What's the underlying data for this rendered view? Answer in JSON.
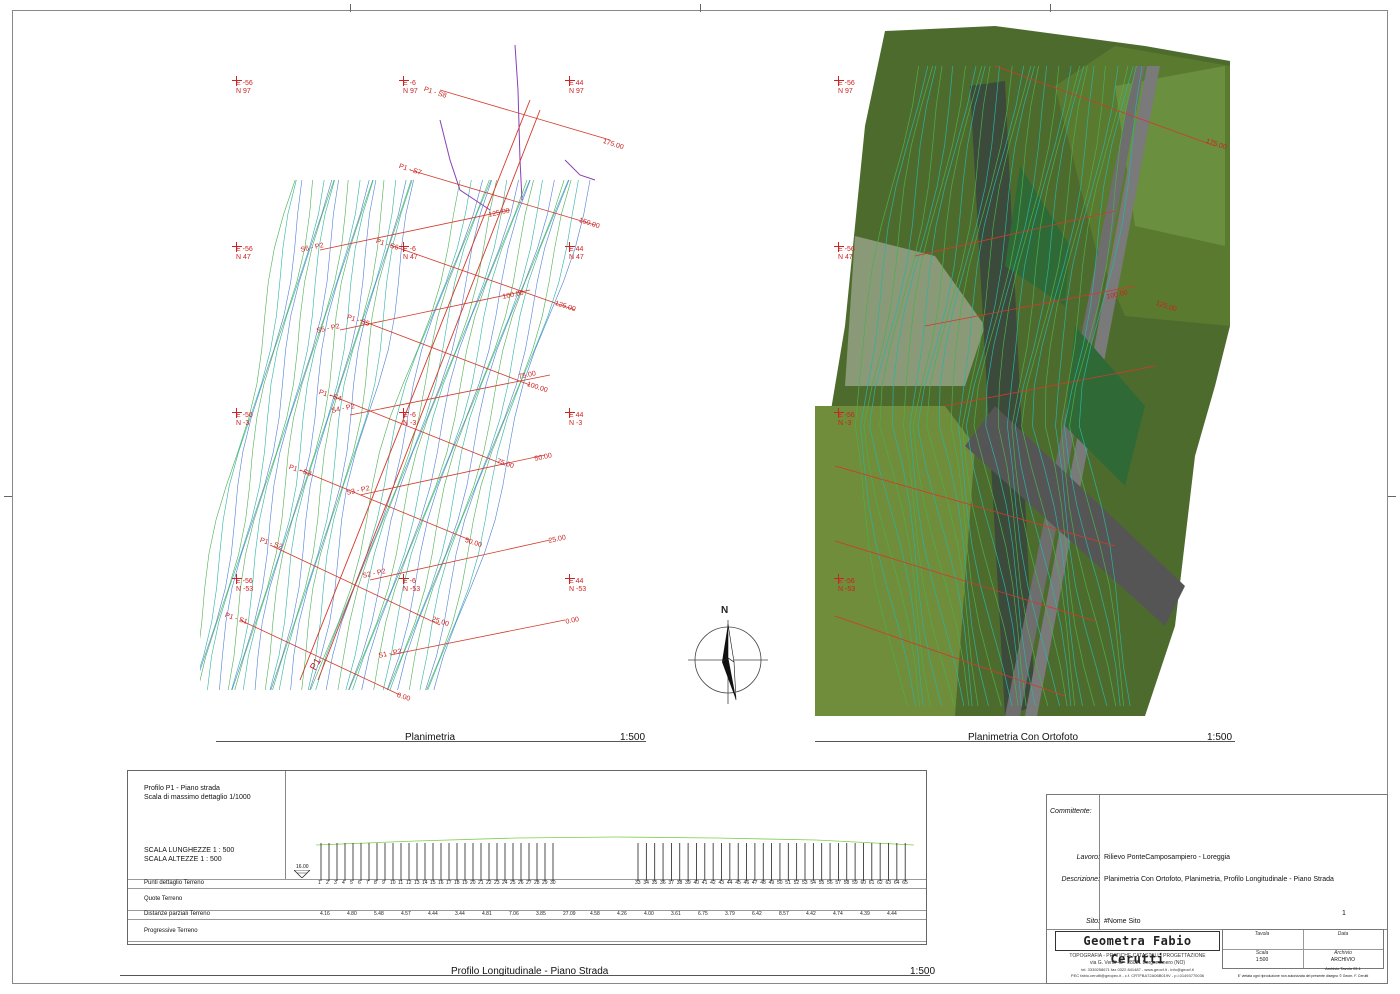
{
  "plan_left": {
    "caption": "Planimetria",
    "scale": "1:500",
    "grid_labels": [
      {
        "e": "E -56",
        "n": "N 97"
      },
      {
        "e": "E -6",
        "n": "N 97"
      },
      {
        "e": "E 44",
        "n": "N 97"
      },
      {
        "e": "E -56",
        "n": "N 47"
      },
      {
        "e": "E -6",
        "n": "N 47"
      },
      {
        "e": "E 44",
        "n": "N 47"
      },
      {
        "e": "E -56",
        "n": "N -3"
      },
      {
        "e": "E -6",
        "n": "N -3"
      },
      {
        "e": "E 44",
        "n": "N -3"
      },
      {
        "e": "E -56",
        "n": "N -53"
      },
      {
        "e": "E -6",
        "n": "N -53"
      },
      {
        "e": "E 44",
        "n": "N -53"
      }
    ],
    "section_labels": [
      "P1 - S8",
      "P1 - S7",
      "P1 - S6",
      "P1 - S5",
      "P1 - S4",
      "P1 - S3",
      "P1 - S2",
      "P1 - S1",
      "S6 - P2",
      "S5 - P2",
      "S4 - P2",
      "S3 - P2",
      "S2 - P2",
      "S1 - P2"
    ],
    "chainage_labels": [
      "175.00",
      "150.00",
      "125.00",
      "125.00",
      "100.00",
      "100.00",
      "75.00",
      "75.00",
      "50.00",
      "50.00",
      "25.00",
      "25.00",
      "0.00",
      "0.00"
    ],
    "axis_label": "P1"
  },
  "plan_right": {
    "caption": "Planimetria Con Ortofoto",
    "scale": "1:500",
    "grid_labels": [
      {
        "e": "E -56",
        "n": "N 97"
      },
      {
        "e": "E -56",
        "n": "N 47"
      },
      {
        "e": "E -56",
        "n": "N -3"
      },
      {
        "e": "E -56",
        "n": "N -53"
      }
    ],
    "chainage_labels": [
      "175.00",
      "125.00",
      "100.00"
    ]
  },
  "north_arrow": {
    "label": "N"
  },
  "profile": {
    "title": "Profilo P1 - Piano strada",
    "subtitle": "Scala di massimo dettaglio 1/1000",
    "scale_lengths": "SCALA LUNGHEZZE 1 : 500",
    "scale_heights": "SCALA ALTEZZE   1 : 500",
    "datum": "16.00",
    "rows": [
      "Punti dettaglio Terreno",
      "Quote Terreno",
      "Distanze parziali Terreno",
      "Progressive Terreno"
    ],
    "point_ids": [
      "1",
      "2",
      "3",
      "4",
      "5",
      "6",
      "7",
      "8",
      "9",
      "10",
      "11",
      "12",
      "13",
      "14",
      "15",
      "16",
      "17",
      "18",
      "19",
      "20",
      "21",
      "22",
      "23",
      "24",
      "25",
      "26",
      "27",
      "28",
      "29",
      "30",
      "33",
      "34",
      "35",
      "36",
      "37",
      "38",
      "39",
      "40",
      "41",
      "42",
      "43",
      "44",
      "45",
      "46",
      "47",
      "48",
      "49",
      "50",
      "51",
      "52",
      "53",
      "54",
      "55",
      "56",
      "57",
      "58",
      "59",
      "60",
      "61",
      "62",
      "63",
      "64",
      "65"
    ],
    "partial_distances": [
      "4.16",
      "4.80",
      "5.48",
      "4.57",
      "4.44",
      "3.44",
      "4.81",
      "7.06",
      "3.85",
      "27.09",
      "4.58",
      "4.26",
      "4.00",
      "3.61",
      "6.75",
      "3.79",
      "6.42",
      "8.57",
      "4.42",
      "4.74",
      "4.39",
      "4.44"
    ],
    "caption": "Profilo Longitudinale - Piano Strada",
    "scale": "1:500"
  },
  "title_block": {
    "committente_label": "Committente:",
    "committente_value": "",
    "lavoro_label": "Lavoro:",
    "lavoro_value": "Rilievo PonteCamposampiero - Loreggia",
    "descrizione_label": "Descrizione:",
    "descrizione_value": "Planimetria Con Ortofoto, Planimetria, Profilo Longitudinale - Piano Strada",
    "sito_label": "Sito:",
    "sito_value": "#Nome Sito",
    "sheet_number": "1",
    "brand": "Geometra Fabio Cerutti",
    "brand_sub": "TOPOGRAFIA - PRATICHE CATASTALI - PROGETTAZIONE",
    "address": "via G. Verdi 48 - 28021 Borgomanero (NO)",
    "contacts": "tel. 3339258671  fax 0322 841487 - www.geocf.it - info@geocf.it",
    "pec": "PEC fabio.cerutti@geopec.it - c.f. CRTFBA72A06B019V - p.i.01493770036",
    "cells": [
      {
        "label": "Tavola",
        "value": ""
      },
      {
        "label": "Data",
        "value": ""
      },
      {
        "label": "Scala",
        "value": "1:500"
      },
      {
        "label": "Archivio",
        "value": "ARCHIVIO"
      }
    ],
    "archive_file": "Archivio Tavolo 03.1",
    "copyright": "E' vietata ogni riproduzione non autorizzata del presente disegno © Geom. F. Cerutti"
  },
  "colors": {
    "contour_green": "#4caf50",
    "contour_teal": "#2bb3a0",
    "contour_blue": "#4f7fd6",
    "section_red": "#d23a2a",
    "boundary_purple": "#8a3fb5"
  }
}
